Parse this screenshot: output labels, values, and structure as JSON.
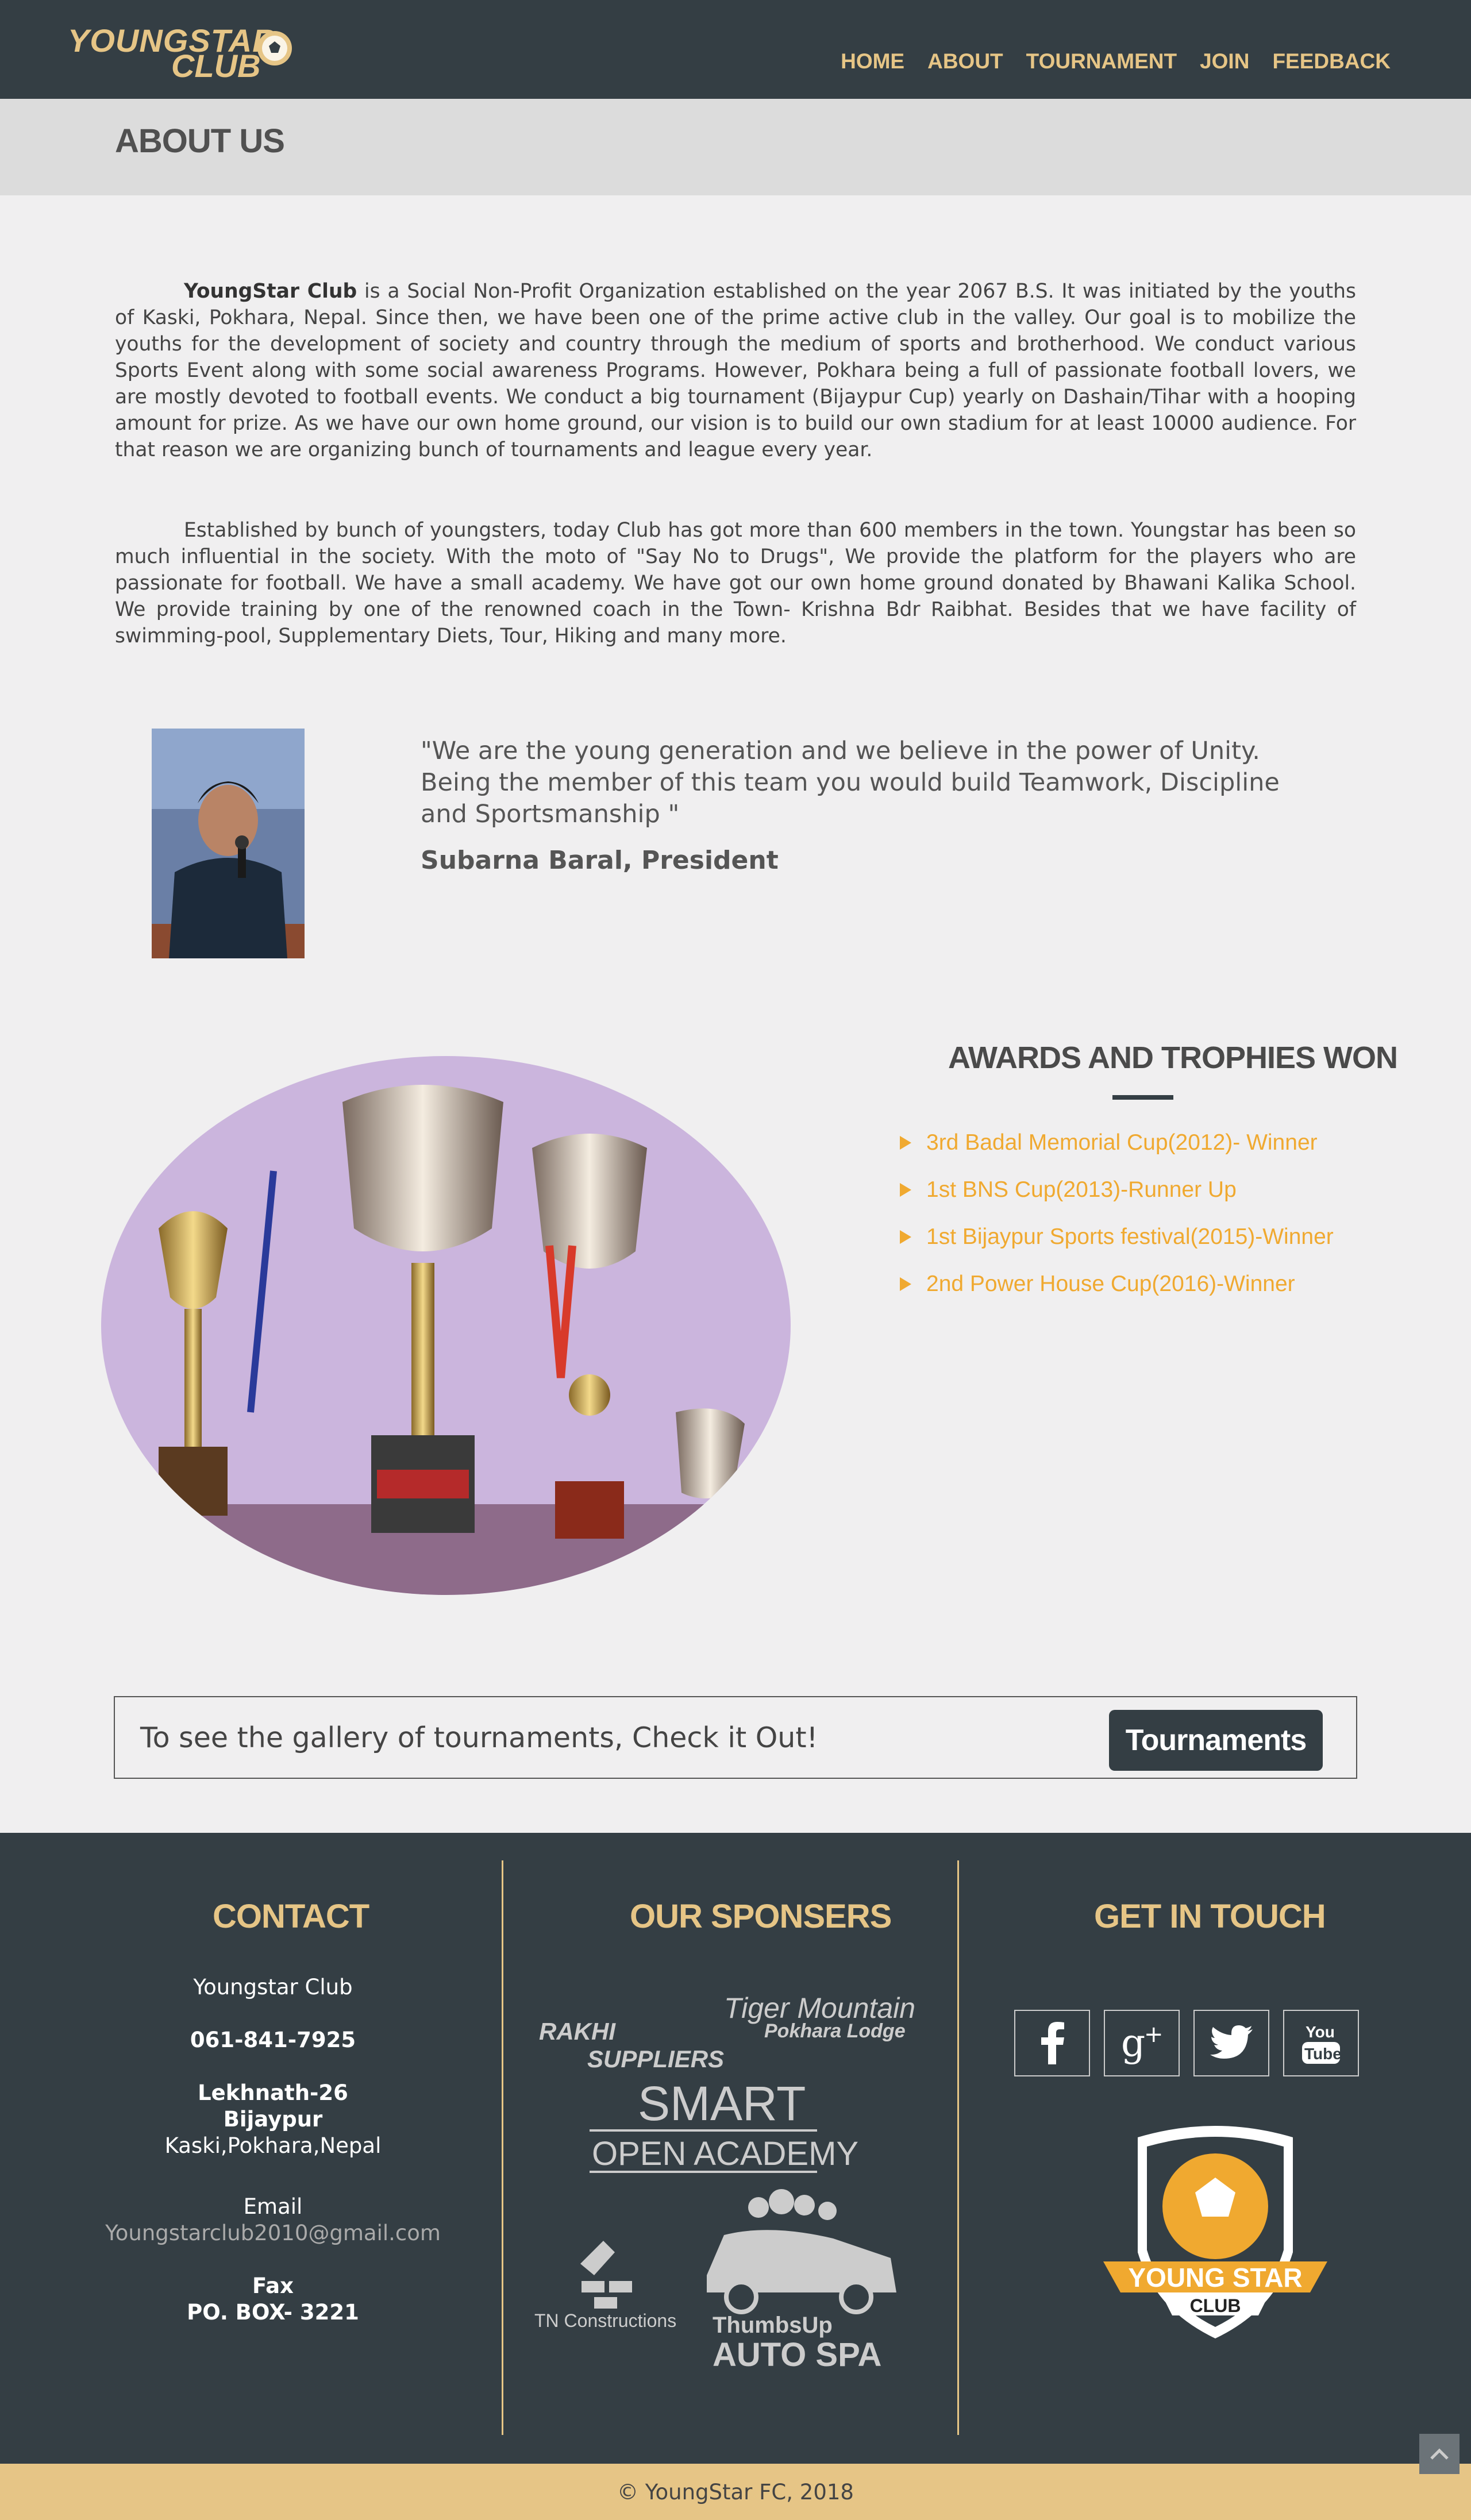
{
  "brand": {
    "line1": "YOUNGSTAR",
    "line2": "CLUB"
  },
  "nav": {
    "items": [
      "HOME",
      "ABOUT",
      "TOURNAMENT",
      "JOIN",
      "FEEDBACK"
    ]
  },
  "about": {
    "title": "ABOUT US",
    "p1_lead": "YoungStar Club",
    "p1_rest": " is a Social Non-Profit Organization established on the year 2067 B.S. It was initiated by the youths of Kaski, Pokhara, Nepal. Since then, we have been one of the prime active club in the valley. Our goal is to mobilize the youths for the development of society and country through the medium of sports and brotherhood. We conduct various Sports Event along with some social awareness Programs. However, Pokhara being a full of passionate football lovers, we are mostly devoted to football events. We conduct a big tournament (Bijaypur Cup) yearly on Dashain/Tihar with a hooping amount for prize. As we have our own home ground, our vision is to build our own stadium for at least 10000 audience. For that reason we are organizing bunch of tournaments and league every year.",
    "p2": "Established by bunch of youngsters, today Club has got more than 600 members in the town. Youngstar has been so much influential in the society. With the moto of \"Say No to Drugs\", We provide the platform for the players who are passionate for football. We have a small academy. We have got our own home ground donated by Bhawani Kalika School. We provide training by one of the renowned coach in the Town- Krishna Bdr Raibhat. Besides that we have facility of swimming-pool, Supplementary Diets, Tour, Hiking and many more."
  },
  "quote": {
    "text": "\"We are the young generation and we believe in the power of Unity. Being the member of this team you would build Teamwork, Discipline and Sportsmanship \"",
    "author": "Subarna Baral, President"
  },
  "awards": {
    "title": "AWARDS AND TROPHIES WON",
    "items": [
      " 3rd Badal Memorial Cup(2012)- Winner",
      "1st BNS Cup(2013)-Runner Up",
      "1st Bijaypur Sports festival(2015)-Winner",
      "2nd Power House Cup(2016)-Winner"
    ]
  },
  "callout": {
    "text": "To see the gallery of tournaments, Check it Out!",
    "button": "Tournaments"
  },
  "footer": {
    "contact": {
      "title": "CONTACT",
      "name": "Youngstar Club",
      "phone": "061-841-7925",
      "addr1": "Lekhnath-26",
      "addr2": "Bijaypur",
      "addr3": "Kaski,Pokhara,Nepal",
      "email_label": "Email",
      "email": "Youngstarclub2010@gmail.com",
      "fax_label": "Fax",
      "fax": "PO. BOX- 3221"
    },
    "sponsors": {
      "title": "OUR SPONSERS",
      "rakhi1": "RAKHI",
      "rakhi2": "SUPPLIERS",
      "tiger1": "Tiger Mountain",
      "tiger2": "Pokhara Lodge",
      "smart1": "SMART",
      "smart2": "OPEN ACADEMY",
      "tn": "TN Constructions",
      "auto1": "ThumbsUp",
      "auto2": "AUTO SPA"
    },
    "touch": {
      "title": "GET IN TOUCH",
      "icons": [
        "facebook-icon",
        "google-plus-icon",
        "twitter-icon",
        "youtube-icon"
      ],
      "crest_line1": "YOUNG STAR",
      "crest_line2": "CLUB"
    },
    "copyright": "© YoungStar FC, 2018"
  },
  "colors": {
    "nav": "#343e44",
    "accent": "#e6c586",
    "award": "#f0a930"
  }
}
